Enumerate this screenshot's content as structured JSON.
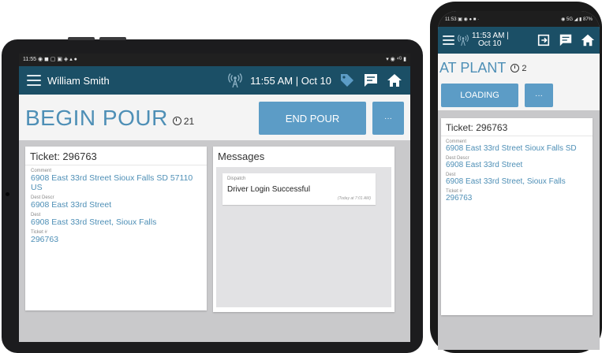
{
  "tablet": {
    "status_time": "11:55",
    "status_icons": "◉ ◼ ▢ ▣ ◈ ▴ ●",
    "status_right": "▾ ◉ ⁴ᴳ ▮",
    "user_name": "William Smith",
    "time_date": "11:55 AM | Oct 10",
    "page_title": "BEGIN POUR",
    "timer": "21",
    "primary_action": "END POUR",
    "more_label": "···",
    "ticket": {
      "title": "Ticket: 296763",
      "fields": [
        {
          "label": "Comment",
          "value": "6908 East 33rd Street Sioux Falls SD 57110 US"
        },
        {
          "label": "Dest Descr",
          "value": "6908 East 33rd Street"
        },
        {
          "label": "Dest",
          "value": "6908 East 33rd Street, Sioux Falls"
        },
        {
          "label": "Ticket #",
          "value": "296763"
        }
      ]
    },
    "messages": {
      "title": "Messages",
      "items": [
        {
          "from": "Dispatch",
          "body": "Driver Login Successful",
          "time": "(Today at 7:01 AM)"
        }
      ]
    }
  },
  "phone": {
    "status_time": "11:53",
    "status_icons": "▣ ◉ ● ■ ·",
    "status_right": "◉ 5G ◢ ▮ 87%",
    "time": "11:53 AM |",
    "date": "Oct 10",
    "page_title": "AT PLANT",
    "timer": "2",
    "primary_action": "LOADING",
    "more_label": "···",
    "ticket": {
      "title": "Ticket: 296763",
      "fields": [
        {
          "label": "Comment",
          "value": "6908 East 33rd Street Sioux Falls SD"
        },
        {
          "label": "Dest Descr",
          "value": "6908 East 33rd Street"
        },
        {
          "label": "Dest",
          "value": "6908 East 33rd Street, Sioux Falls"
        },
        {
          "label": "Ticket #",
          "value": "296763"
        }
      ]
    }
  },
  "colors": {
    "appbar": "#1b4f66",
    "accent": "#4e8fb6",
    "button": "#5c9cc6"
  },
  "icons": [
    "menu-icon",
    "antenna-icon",
    "tag-icon",
    "chat-icon",
    "home-icon",
    "clock-icon",
    "exit-icon"
  ]
}
